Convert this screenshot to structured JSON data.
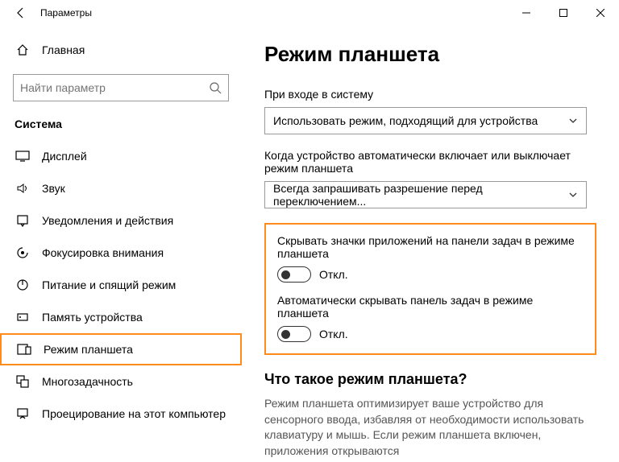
{
  "window": {
    "title": "Параметры"
  },
  "sidebar": {
    "home": "Главная",
    "search_placeholder": "Найти параметр",
    "category": "Система",
    "items": [
      {
        "label": "Дисплей"
      },
      {
        "label": "Звук"
      },
      {
        "label": "Уведомления и действия"
      },
      {
        "label": "Фокусировка внимания"
      },
      {
        "label": "Питание и спящий режим"
      },
      {
        "label": "Память устройства"
      },
      {
        "label": "Режим планшета"
      },
      {
        "label": "Многозадачность"
      },
      {
        "label": "Проецирование на этот компьютер"
      }
    ],
    "selected_index": 6
  },
  "page": {
    "title": "Режим планшета",
    "signin_label": "При входе в систему",
    "signin_value": "Использовать режим, подходящий для устройства",
    "switch_label": "Когда устройство автоматически включает или выключает режим планшета",
    "switch_value": "Всегда запрашивать разрешение перед переключением...",
    "toggle1_label": "Скрывать значки приложений на панели задач в режиме планшета",
    "toggle1_state": "Откл.",
    "toggle2_label": "Автоматически скрывать панель задач в режиме планшета",
    "toggle2_state": "Откл.",
    "about_heading": "Что такое режим планшета?",
    "about_text": "Режим планшета оптимизирует ваше устройство для сенсорного ввода, избавляя от необходимости использовать клавиатуру и мышь. Если режим планшета включен, приложения открываются"
  }
}
